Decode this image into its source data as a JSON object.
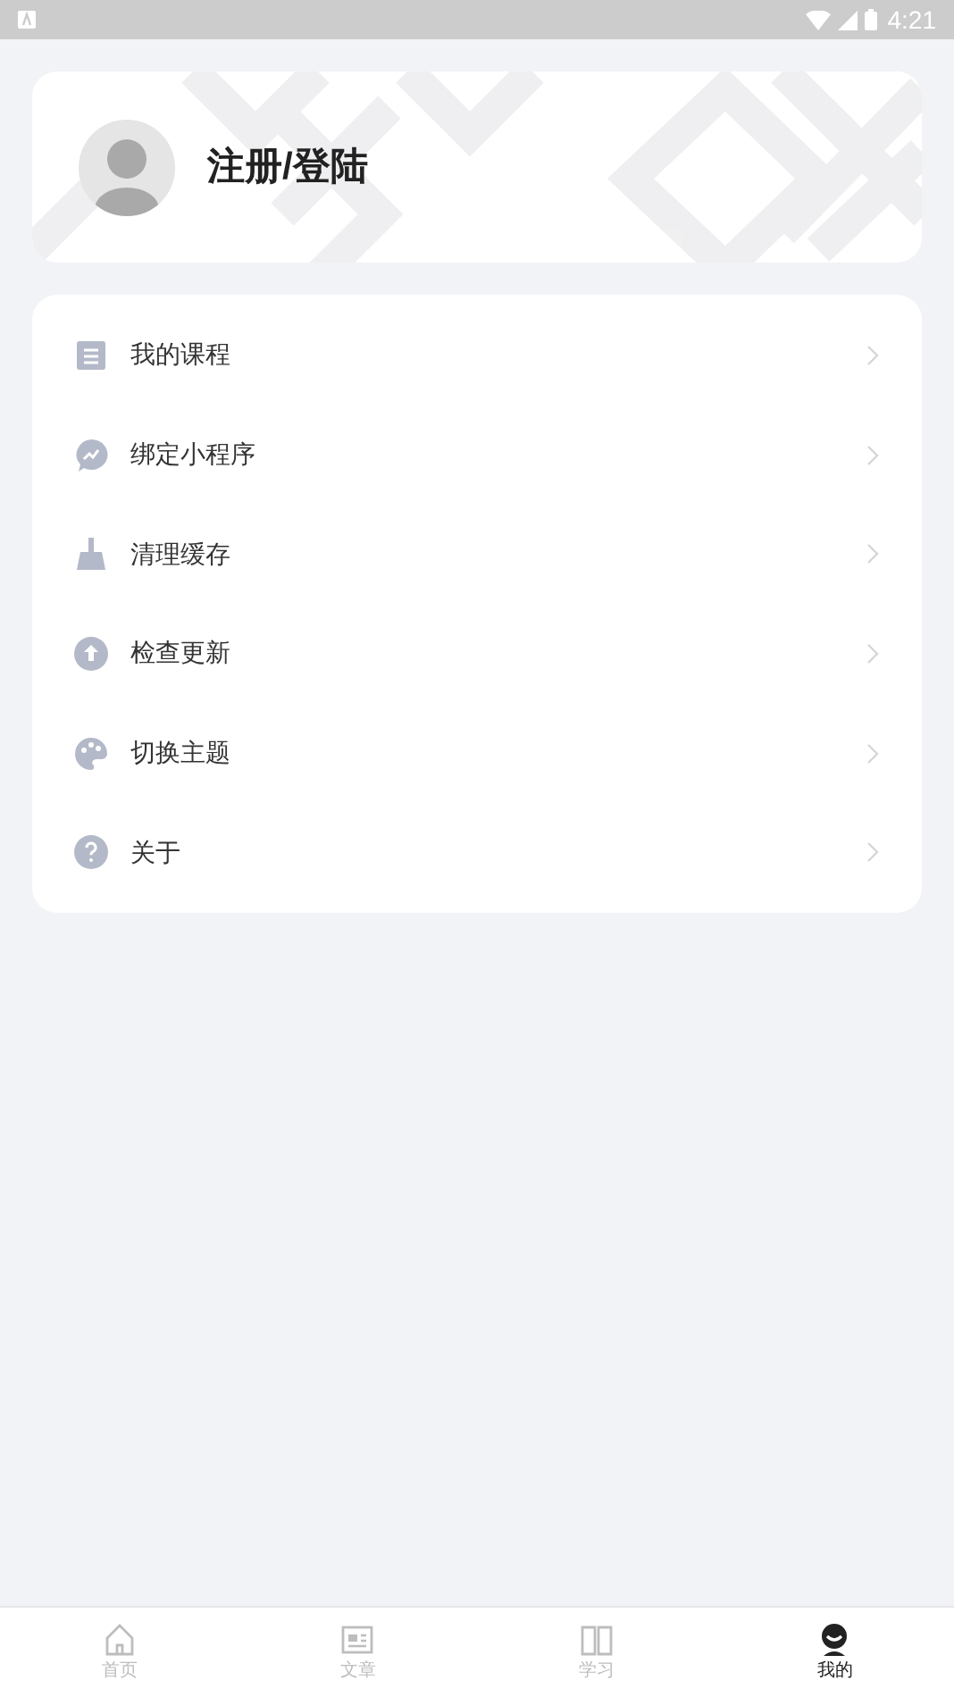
{
  "status_bar": {
    "time": "4:21"
  },
  "profile": {
    "title": "注册/登陆"
  },
  "menu": [
    {
      "kind": "courses",
      "label": "我的课程"
    },
    {
      "kind": "miniprogram",
      "label": "绑定小程序"
    },
    {
      "kind": "clean",
      "label": "清理缓存"
    },
    {
      "kind": "update",
      "label": "检查更新"
    },
    {
      "kind": "theme",
      "label": "切换主题"
    },
    {
      "kind": "about",
      "label": "关于"
    }
  ],
  "tabs": [
    {
      "kind": "home",
      "label": "首页",
      "selected": false
    },
    {
      "kind": "articles",
      "label": "文章",
      "selected": false
    },
    {
      "kind": "study",
      "label": "学习",
      "selected": false
    },
    {
      "kind": "me",
      "label": "我的",
      "selected": true
    }
  ]
}
